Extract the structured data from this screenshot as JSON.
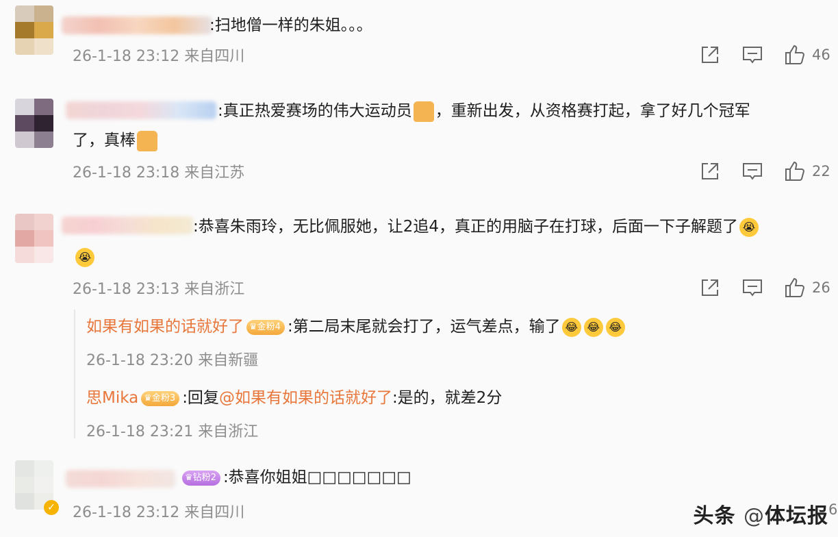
{
  "comments": [
    {
      "text": ":扫地僧一样的朱姐。。。",
      "meta": "26-1-18 23:12 来自四川",
      "likes": "46"
    },
    {
      "text_line1_a": ":真正热爱赛场的伟大运动员",
      "text_line1_b": "，重新出发，从资格赛打起，拿了好几个冠军",
      "text_line2": "了，真棒",
      "meta": "26-1-18 23:18 来自江苏",
      "likes": "22"
    },
    {
      "text": ":恭喜朱雨玲，无比佩服她，让2追4，真正的用脑子在打球，后面一下子解题了",
      "meta": "26-1-18 23:13 来自浙江",
      "likes": "26",
      "replies": [
        {
          "name": "如果有如果的话就好了",
          "badge": "金粉4",
          "text": ":第二局末尾就会打了，运气差点，输了",
          "meta": "26-1-18 23:20 来自新疆"
        },
        {
          "name": "思Mika",
          "badge": "金粉3",
          "text_prefix": ":回复",
          "mention": "@如果有如果的话就好了",
          "text_suffix": ":是的，就差2分",
          "meta": "26-1-18 23:21 来自浙江"
        }
      ]
    },
    {
      "badge": "钻粉2",
      "text": ":恭喜你姐姐□□□□□□□",
      "meta": "26-1-18 23:12 来自四川",
      "likes": "6"
    }
  ],
  "watermark": {
    "source": "头条",
    "at": "@",
    "account": "体坛报"
  },
  "icons": [
    "share-icon",
    "comment-icon",
    "like-icon"
  ],
  "colors": {
    "accent": "#e8763a",
    "meta": "#8d8d8d"
  }
}
